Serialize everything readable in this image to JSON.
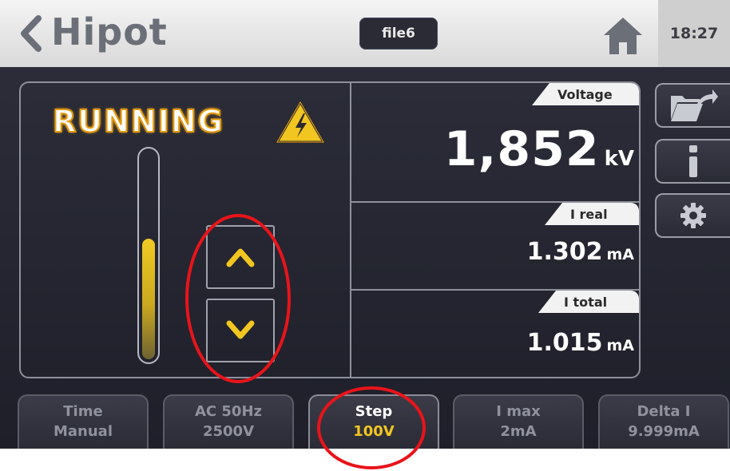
{
  "header": {
    "title": "Hipot",
    "file": "file6",
    "time": "18:27"
  },
  "status": {
    "state": "RUNNING",
    "gauge_level": 0.58
  },
  "measurements": {
    "voltage": {
      "label": "Voltage",
      "value": "1,852",
      "unit": "kV"
    },
    "i_real": {
      "label": "I real",
      "value": "1.302",
      "unit": "mA"
    },
    "i_total": {
      "label": "I total",
      "value": "1.015",
      "unit": "mA"
    }
  },
  "params": [
    {
      "line1": "Time",
      "line2": "Manual"
    },
    {
      "line1": "AC 50Hz",
      "line2": "2500V"
    },
    {
      "line1": "Step",
      "line2": "100V"
    },
    {
      "line1": "I max",
      "line2": "2mA"
    },
    {
      "line1": "Delta I",
      "line2": "9.999mA"
    }
  ],
  "icons": {
    "back": "chevron-left-icon",
    "home": "home-icon",
    "warning": "high-voltage-warning-icon",
    "up": "chevron-up-icon",
    "down": "chevron-down-icon",
    "folder": "folder-export-icon",
    "info": "info-icon",
    "settings": "gear-icon"
  },
  "colors": {
    "accent_yellow": "#f2c620",
    "running_glow": "#e59b10",
    "annotation_red": "#e8141a"
  }
}
